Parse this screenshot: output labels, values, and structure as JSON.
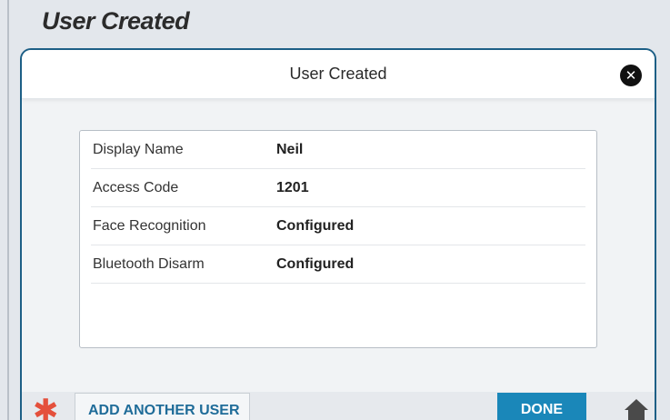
{
  "page": {
    "heading": "User Created"
  },
  "dialog": {
    "title": "User Created",
    "close_icon": "close-icon"
  },
  "details": [
    {
      "label": "Display Name",
      "value": "Neil"
    },
    {
      "label": "Access Code",
      "value": "1201"
    },
    {
      "label": "Face Recognition",
      "value": "Configured"
    },
    {
      "label": "Bluetooth Disarm",
      "value": "Configured"
    }
  ],
  "footer": {
    "asterisk_icon": "asterisk-icon",
    "add_user_label": "ADD ANOTHER USER",
    "done_label": "DONE",
    "home_icon": "home-icon"
  },
  "colors": {
    "accent": "#1a87b9",
    "dialog_border": "#1d5f86",
    "asterisk": "#e4503c",
    "add_user_text": "#1f6c99"
  }
}
